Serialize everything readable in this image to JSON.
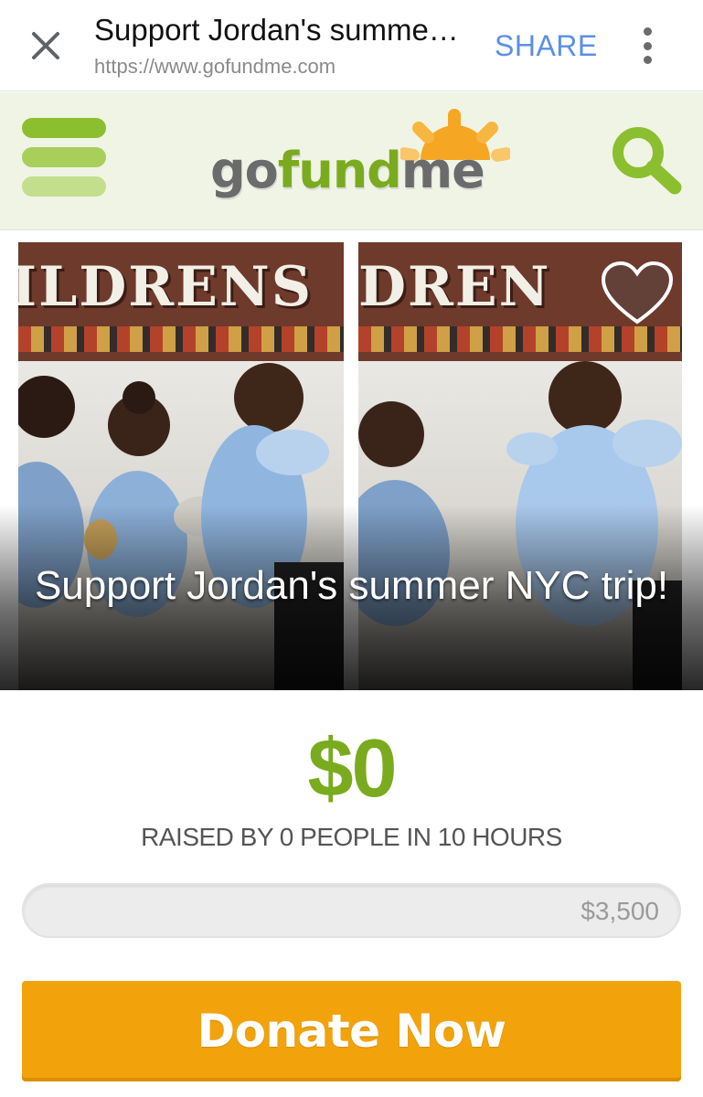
{
  "browser": {
    "page_title": "Support Jordan's summe…",
    "url": "https://www.gofundme.com",
    "share_label": "SHARE",
    "icons": {
      "close": "close-icon",
      "more": "more-vertical-icon"
    }
  },
  "site": {
    "logo": {
      "go": "go",
      "fund": "fund",
      "me": "me"
    },
    "icons": {
      "menu": "hamburger-menu-icon",
      "search": "search-icon"
    },
    "colors": {
      "brand_green": "#7aab1f",
      "header_bg": "#f0f4e4",
      "donate_orange": "#f2a30c",
      "sun_orange": "#f5a623"
    }
  },
  "campaign": {
    "banner_left": "ILDRENS",
    "banner_right": "DREN",
    "title": "Support Jordan's summer NYC trip!",
    "favorite_icon": "heart-icon",
    "raised_amount": "$0",
    "raised_summary": "RAISED BY 0 PEOPLE IN 10 HOURS",
    "progress_fraction": 0,
    "goal": "$3,500",
    "donate_label": "Donate Now"
  }
}
